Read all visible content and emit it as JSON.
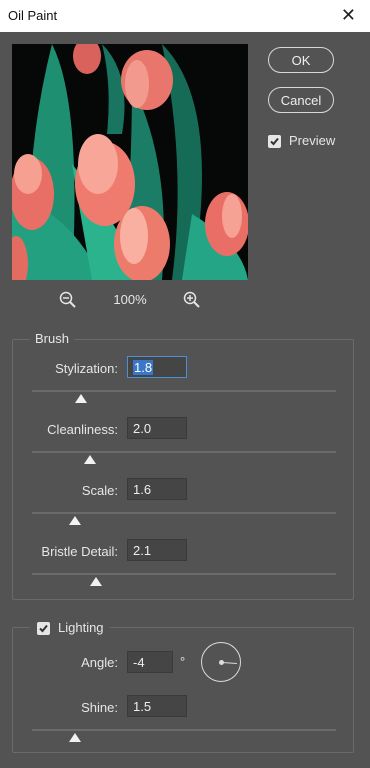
{
  "window": {
    "title": "Oil Paint"
  },
  "buttons": {
    "ok": "OK",
    "cancel": "Cancel"
  },
  "preview": {
    "label": "Preview",
    "checked": true
  },
  "zoom": {
    "level": "100%"
  },
  "brush": {
    "group_label": "Brush",
    "params": [
      {
        "label": "Stylization:",
        "value": "1.8",
        "slider_fraction": 0.16
      },
      {
        "label": "Cleanliness:",
        "value": "2.0",
        "slider_fraction": 0.19
      },
      {
        "label": "Scale:",
        "value": "1.6",
        "slider_fraction": 0.14
      },
      {
        "label": "Bristle Detail:",
        "value": "2.1",
        "slider_fraction": 0.21
      }
    ]
  },
  "lighting": {
    "group_label": "Lighting",
    "checked": true,
    "angle": {
      "label": "Angle:",
      "value": "-4",
      "unit": "°"
    },
    "shine": {
      "label": "Shine:",
      "value": "1.5",
      "slider_fraction": 0.14
    }
  },
  "colors": {
    "background": "#535353",
    "accent": "#3a77c9"
  }
}
